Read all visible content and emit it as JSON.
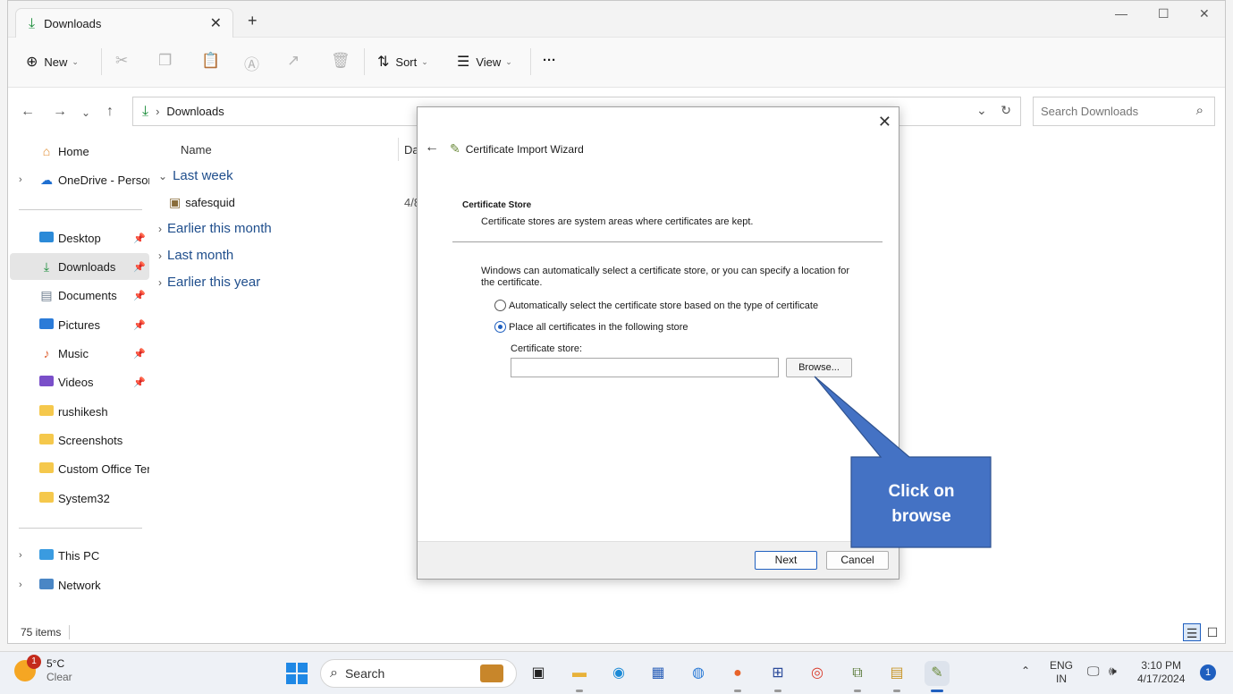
{
  "window": {
    "tab_label": "Downloads",
    "tab_close": "✕",
    "new_tab": "+",
    "minimize": "—",
    "maximize": "☐",
    "close": "✕"
  },
  "toolbar": {
    "new_label": "New",
    "sort_label": "Sort",
    "view_label": "View",
    "more_label": "···"
  },
  "address": {
    "folder": "Downloads",
    "search_placeholder": "Search Downloads"
  },
  "sidebar": {
    "items": [
      {
        "label": "Home"
      },
      {
        "label": "OneDrive - Persona"
      },
      {
        "label": "Desktop"
      },
      {
        "label": "Downloads"
      },
      {
        "label": "Documents"
      },
      {
        "label": "Pictures"
      },
      {
        "label": "Music"
      },
      {
        "label": "Videos"
      },
      {
        "label": "rushikesh"
      },
      {
        "label": "Screenshots"
      },
      {
        "label": "Custom Office Tem"
      },
      {
        "label": "System32"
      },
      {
        "label": "This PC"
      },
      {
        "label": "Network"
      }
    ]
  },
  "content": {
    "col_name": "Name",
    "col_date": "Dat",
    "groups": [
      "Last week",
      "Earlier this month",
      "Last month",
      "Earlier this year"
    ],
    "file_name": "safesquid",
    "file_date": "4/8"
  },
  "status": {
    "count": "75 items"
  },
  "dialog": {
    "title": "Certificate Import Wizard",
    "heading": "Certificate Store",
    "subheading": "Certificate stores are system areas where certificates are kept.",
    "description": "Windows can automatically select a certificate store, or you can specify a location for the certificate.",
    "radio_auto": "Automatically select the certificate store based on the type of certificate",
    "radio_place": "Place all certificates in the following store",
    "store_label": "Certificate store:",
    "store_value": "",
    "browse_label": "Browse...",
    "next_label": "Next",
    "cancel_label": "Cancel"
  },
  "callout": {
    "line1": "Click on",
    "line2": "browse",
    "fill_color": "#4472c4",
    "border_color": "#2f528f"
  },
  "taskbar": {
    "weather_temp": "5°C",
    "weather_cond": "Clear",
    "weather_badge": "1",
    "search_label": "Search",
    "lang": "ENG",
    "region": "IN",
    "time": "3:10 PM",
    "date": "4/17/2024",
    "notif_count": "1"
  }
}
